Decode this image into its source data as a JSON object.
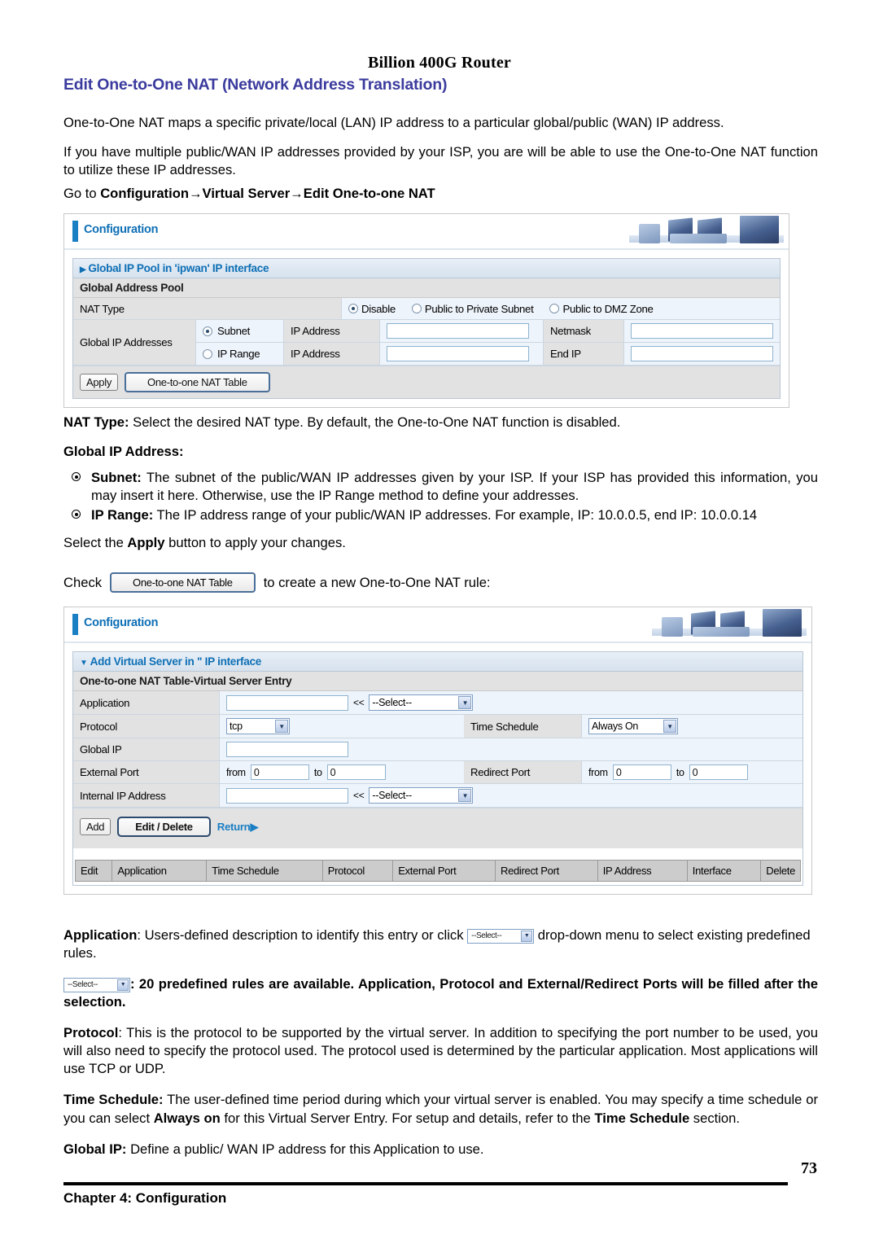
{
  "running_head": "Billion 400G Router",
  "section_title": "Edit One-to-One NAT (Network Address Translation)",
  "intro": {
    "p1": "One-to-One NAT maps a specific private/local (LAN) IP address to a particular global/public (WAN) IP address.",
    "p2": "If you have multiple public/WAN IP addresses provided by your ISP, you are will be able to use the One-to-One NAT function to utilize these IP addresses.",
    "goto_prefix": "Go to ",
    "goto_path": "Configuration→Virtual Server→Edit One-to-one NAT"
  },
  "panel1": {
    "topbar_label": "Configuration",
    "section_header": "Global IP Pool in 'ipwan' IP interface",
    "sub_header": "Global Address Pool",
    "nat_type_label": "NAT Type",
    "nat_type_options": [
      {
        "label": "Disable",
        "selected": true
      },
      {
        "label": "Public to Private Subnet",
        "selected": false
      },
      {
        "label": "Public to DMZ Zone",
        "selected": false
      }
    ],
    "global_ip_label": "Global IP Addresses",
    "subnet_option": "Subnet",
    "iprange_option": "IP Range",
    "ip_address_label": "IP Address",
    "netmask_label": "Netmask",
    "endip_label": "End IP",
    "ip_address_value": "",
    "netmask_value": "",
    "iprange_address_value": "",
    "endip_value": "",
    "apply_button": "Apply",
    "nat_table_button": "One-to-one NAT Table"
  },
  "mid": {
    "nat_type_bold": "NAT Type:",
    "nat_type_text": " Select the desired NAT type. By default, the One-to-One NAT function is disabled.",
    "global_ip_heading": "Global IP Address:",
    "bullet_subnet_bold": "Subnet:",
    "bullet_subnet_text": " The subnet of the public/WAN IP addresses given by your ISP. If your ISP has provided this information, you may insert it here. Otherwise, use the IP Range method to define your addresses.",
    "bullet_range_bold": "IP Range:",
    "bullet_range_text": " The IP address range of your public/WAN IP addresses. For example, IP: 10.0.0.5, end IP: 10.0.0.14",
    "apply_line_pre": "Select the ",
    "apply_line_bold": "Apply",
    "apply_line_post": " button to apply your changes.",
    "check_pre": "Check",
    "check_button": "One-to-one NAT Table",
    "check_post": "to create a new One-to-One NAT rule:"
  },
  "panel2": {
    "topbar_label": "Configuration",
    "section_header": "Add Virtual Server in \" IP interface",
    "sub_header": "One-to-one NAT Table-Virtual Server Entry",
    "rows": {
      "application_label": "Application",
      "application_value": "",
      "application_arrows": "<<",
      "application_select": "--Select--",
      "protocol_label": "Protocol",
      "protocol_select": "tcp",
      "time_schedule_label": "Time Schedule",
      "time_schedule_select": "Always On",
      "global_ip_label": "Global IP",
      "global_ip_value": "",
      "external_port_label": "External Port",
      "external_from_label": "from",
      "external_from_value": "0",
      "external_to_label": "to",
      "external_to_value": "0",
      "redirect_port_label": "Redirect Port",
      "redirect_from_label": "from",
      "redirect_from_value": "0",
      "redirect_to_label": "to",
      "redirect_to_value": "0",
      "internal_ip_label": "Internal IP Address",
      "internal_ip_value": "",
      "internal_arrows": "<<",
      "internal_select": "--Select--"
    },
    "buttons": {
      "add": "Add",
      "edit_delete": "Edit / Delete",
      "return": "Return"
    },
    "table_headers": [
      "Edit",
      "Application",
      "Time Schedule",
      "Protocol",
      "External Port",
      "Redirect Port",
      "IP Address",
      "Interface",
      "Delete"
    ]
  },
  "bottom": {
    "application_bold": "Application",
    "application_pre": ": Users-defined description to identify this entry or click",
    "application_post": "drop-down menu to select existing predefined rules.",
    "select_chip_label": "--Select--",
    "select_line": ": 20 predefined rules are available. Application, Protocol and External/Redirect Ports will be filled after the selection.",
    "protocol_bold": "Protocol",
    "protocol_text": ": This is the protocol to be supported by the virtual server. In addition to specifying the port number to be used, you will also need to specify the protocol used. The protocol used is determined by the particular application. Most applications will use TCP or UDP.",
    "timesched_bold": "Time Schedule:",
    "timesched_t1": " The user-defined time period during which your virtual server is enabled. You may specify a time schedule or you can select ",
    "timesched_b2": "Always on",
    "timesched_t2": " for this Virtual Server Entry. For setup and details, refer to the ",
    "timesched_b3": "Time Schedule",
    "timesched_t3": " section.",
    "globalip_bold": "Global IP:",
    "globalip_text": " Define a public/ WAN IP address for this Application to use."
  },
  "footer": {
    "page_number": "73",
    "chapter": "Chapter 4: Configuration"
  },
  "colors": {
    "title_blue": "#3b3b9e",
    "ui_blue": "#0e6fb5",
    "accent_bar": "#1b7fc4",
    "label_gray": "#e2e2e2",
    "value_blue": "#eef4fb",
    "table_header_gray": "#cccccc"
  }
}
